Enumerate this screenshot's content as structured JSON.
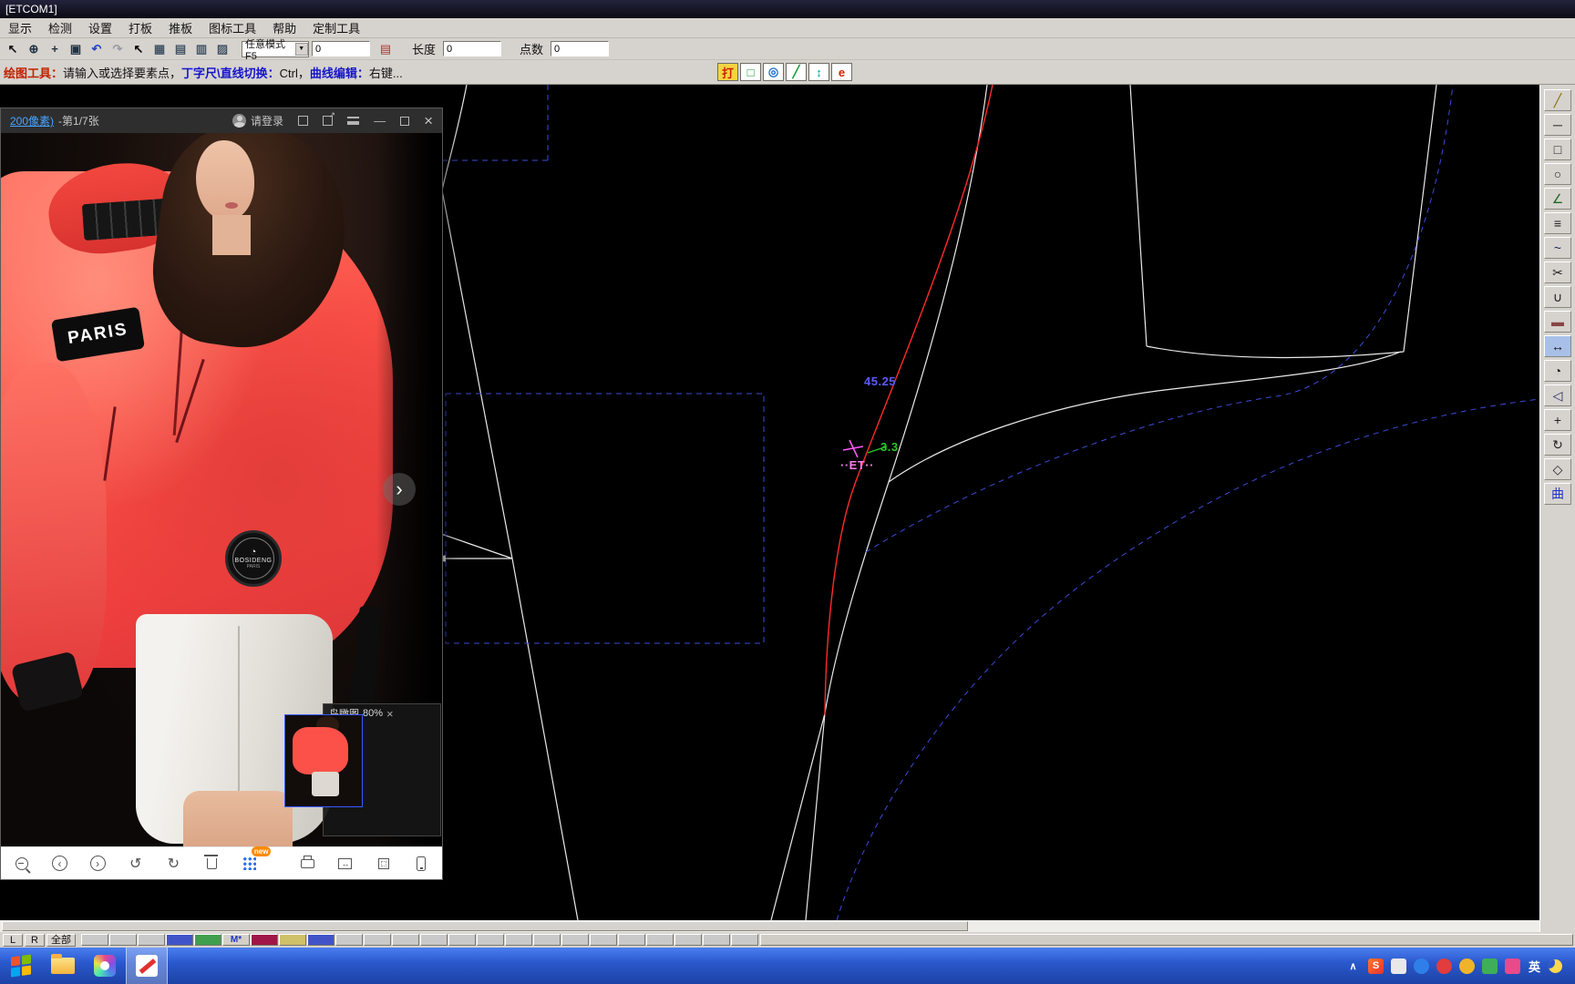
{
  "titlebar": {
    "title": "[ETCOM1]"
  },
  "menubar": {
    "items": [
      {
        "name": "menu-display",
        "label": "显示"
      },
      {
        "name": "menu-detect",
        "label": "检测"
      },
      {
        "name": "menu-settings",
        "label": "设置"
      },
      {
        "name": "menu-pattern",
        "label": "打板"
      },
      {
        "name": "menu-grading",
        "label": "推板"
      },
      {
        "name": "menu-icon-tools",
        "label": "图标工具"
      },
      {
        "name": "menu-help",
        "label": "帮助"
      },
      {
        "name": "menu-custom-tools",
        "label": "定制工具"
      }
    ]
  },
  "toolbar": {
    "icons": [
      {
        "name": "select-arrow-icon",
        "glyph": "↖",
        "color": "#111111"
      },
      {
        "name": "zoom-in-icon",
        "glyph": "⊕",
        "color": "#223344"
      },
      {
        "name": "pan-icon",
        "glyph": "+",
        "color": "#223344"
      },
      {
        "name": "zoom-area-icon",
        "glyph": "▣",
        "color": "#223344"
      },
      {
        "name": "undo-icon",
        "glyph": "↶",
        "color": "#2244cc"
      },
      {
        "name": "redo-icon",
        "glyph": "↷",
        "color": "#9a9aa6"
      },
      {
        "name": "pick-arrow-icon",
        "glyph": "↖",
        "color": "#000000"
      },
      {
        "name": "table-tool-1-icon",
        "glyph": "▦",
        "color": "#445566"
      },
      {
        "name": "table-tool-2-icon",
        "glyph": "▤",
        "color": "#445566"
      },
      {
        "name": "table-tool-3-icon",
        "glyph": "▥",
        "color": "#445566"
      },
      {
        "name": "table-tool-4-icon",
        "glyph": "▨",
        "color": "#445566"
      }
    ],
    "mode": "任意模式F5",
    "dropdown_arrow": "▼",
    "value": "0",
    "doc_icon": "▤",
    "length_label": "长度",
    "length_value": "0",
    "count_label": "点数",
    "count_value": "0"
  },
  "hintbar": {
    "seg1": "绘图工具：",
    "seg2": "请输入或选择要素点，",
    "seg3": "丁字尺\\直线切换：",
    "seg4": " Ctrl，",
    "seg5": "曲线编辑：",
    "seg6": " 右键...",
    "toggles": [
      {
        "name": "toggle-da",
        "glyph": "打",
        "color": "#cc2200",
        "bg": "#f5d442"
      },
      {
        "name": "toggle-rect",
        "glyph": "□",
        "color": "#1a9c3c",
        "bg": "#ffffff"
      },
      {
        "name": "toggle-point",
        "glyph": "◎",
        "color": "#1a6ccc",
        "bg": "#ffffff"
      },
      {
        "name": "toggle-line",
        "glyph": "╱",
        "color": "#1a9c3c",
        "bg": "#ffffff"
      },
      {
        "name": "toggle-swap",
        "glyph": "↕",
        "color": "#00a0a0",
        "bg": "#ffffff"
      },
      {
        "name": "toggle-e",
        "glyph": "e",
        "color": "#cc2200",
        "bg": "#ffffff"
      }
    ]
  },
  "canvas": {
    "dim_length": "45.25",
    "dim_angle": "3.3",
    "dim_label": "··ET··"
  },
  "viewer": {
    "title_link": "200像素)",
    "title_rest": " -第1/7张",
    "login": "请登录",
    "open_arrow": "↗",
    "min_glyph": "—",
    "close_glyph": "×",
    "paris": "PARIS",
    "logo_glyph": "◔",
    "logo_title": "BOSIDENG",
    "logo_sub": "PARIS",
    "next": "›",
    "prev_glyph": "‹",
    "next_glyph": "›",
    "rotate_left_glyph": "↺",
    "rotate_right_glyph": "↻",
    "fit_glyph": "↔",
    "new_badge": "new",
    "be_title": "鸟瞰图",
    "be_zoom": "80%",
    "be_close": "×"
  },
  "right_toolbar": {
    "tools": [
      {
        "name": "pencil-tool",
        "glyph": "╱",
        "color": "#8a6d00",
        "bg": ""
      },
      {
        "name": "line-tool",
        "glyph": "─",
        "color": "#222222",
        "bg": ""
      },
      {
        "name": "rect-tool",
        "glyph": "□",
        "color": "#222222",
        "bg": ""
      },
      {
        "name": "circle-tool",
        "glyph": "○",
        "color": "#222222",
        "bg": ""
      },
      {
        "name": "angle-line-tool",
        "glyph": "∠",
        "color": "#226622",
        "bg": ""
      },
      {
        "name": "divide-tool",
        "glyph": "≡",
        "color": "#222222",
        "bg": ""
      },
      {
        "name": "curve-tool",
        "glyph": "~",
        "color": "#222266",
        "bg": ""
      },
      {
        "name": "scissors-tool",
        "glyph": "✂",
        "color": "#222222",
        "bg": ""
      },
      {
        "name": "join-tool",
        "glyph": "∪",
        "color": "#222222",
        "bg": ""
      },
      {
        "name": "eraser-tool",
        "glyph": "▬",
        "color": "#884444",
        "bg": ""
      },
      {
        "name": "measure-tool",
        "glyph": "↔",
        "color": "#111111",
        "bg": "#a8c0e8"
      },
      {
        "name": "protractor-tool",
        "glyph": "◔",
        "color": "#222222",
        "bg": ""
      },
      {
        "name": "mirror-tool",
        "glyph": "◁",
        "color": "#222266",
        "bg": ""
      },
      {
        "name": "move-tool",
        "glyph": "+",
        "color": "#222222",
        "bg": ""
      },
      {
        "name": "rotate-tool",
        "glyph": "↻",
        "color": "#222222",
        "bg": ""
      },
      {
        "name": "scale-tool",
        "glyph": "◇",
        "color": "#222222",
        "bg": ""
      },
      {
        "name": "curve-mode-label",
        "glyph": "曲",
        "color": "#2233cc",
        "bg": ""
      }
    ]
  },
  "palette": {
    "left": "L",
    "right": "R",
    "all": "全部",
    "swatches": [
      {
        "name": "swatch-gray-1",
        "bg": "#c9c9c9",
        "label": ""
      },
      {
        "name": "swatch-gray-2",
        "bg": "#c9c9c9",
        "label": ""
      },
      {
        "name": "swatch-gray-3",
        "bg": "#c9c9c9",
        "label": ""
      },
      {
        "name": "swatch-blue-1",
        "bg": "#4054c8",
        "label": ""
      },
      {
        "name": "swatch-green",
        "bg": "#3f9f4f",
        "label": ""
      },
      {
        "name": "swatch-m",
        "bg": "#d4d0c8",
        "label": "M*"
      },
      {
        "name": "swatch-crimson",
        "bg": "#a01648",
        "label": ""
      },
      {
        "name": "swatch-khaki",
        "bg": "#cfc06a",
        "label": ""
      },
      {
        "name": "swatch-blue-2",
        "bg": "#4054c8",
        "label": ""
      },
      {
        "name": "swatch-gray-4",
        "bg": "#c9c9c9",
        "label": ""
      },
      {
        "name": "swatch-gray-5",
        "bg": "#c9c9c9",
        "label": ""
      },
      {
        "name": "swatch-gray-6",
        "bg": "#c9c9c9",
        "label": ""
      },
      {
        "name": "swatch-gray-7",
        "bg": "#c9c9c9",
        "label": ""
      },
      {
        "name": "swatch-gray-8",
        "bg": "#c9c9c9",
        "label": ""
      },
      {
        "name": "swatch-gray-9",
        "bg": "#c9c9c9",
        "label": ""
      },
      {
        "name": "swatch-gray-10",
        "bg": "#c9c9c9",
        "label": ""
      },
      {
        "name": "swatch-gray-11",
        "bg": "#c9c9c9",
        "label": ""
      },
      {
        "name": "swatch-gray-12",
        "bg": "#c9c9c9",
        "label": ""
      },
      {
        "name": "swatch-gray-13",
        "bg": "#c9c9c9",
        "label": ""
      },
      {
        "name": "swatch-gray-14",
        "bg": "#c9c9c9",
        "label": ""
      },
      {
        "name": "swatch-gray-15",
        "bg": "#c9c9c9",
        "label": ""
      },
      {
        "name": "swatch-gray-16",
        "bg": "#c9c9c9",
        "label": ""
      },
      {
        "name": "swatch-gray-17",
        "bg": "#c9c9c9",
        "label": ""
      },
      {
        "name": "swatch-gray-18",
        "bg": "#c9c9c9",
        "label": ""
      }
    ]
  },
  "taskbar": {
    "tray": [
      {
        "name": "tray-expand-icon",
        "glyph": "∧",
        "bg": "",
        "color": "#ffffff",
        "shape": ""
      },
      {
        "name": "tray-sogou-icon",
        "glyph": "S",
        "bg": "linear-gradient(135deg,#ff7a2a,#e83030)",
        "color": "#ffffff",
        "shape": "box"
      },
      {
        "name": "tray-ime-icon",
        "glyph": "",
        "bg": "#e8e8e8",
        "color": "#333333",
        "shape": "box"
      },
      {
        "name": "tray-app-blue-icon",
        "glyph": "",
        "bg": "#2f7fe8",
        "color": "#ffffff",
        "shape": "circle"
      },
      {
        "name": "tray-app-red-icon",
        "glyph": "",
        "bg": "#e23c3c",
        "color": "#ffffff",
        "shape": "circle"
      },
      {
        "name": "tray-app-yellow-icon",
        "glyph": "",
        "bg": "#f0b429",
        "color": "#ffffff",
        "shape": "circle"
      },
      {
        "name": "tray-app-green-icon",
        "glyph": "",
        "bg": "#3fae58",
        "color": "#ffffff",
        "shape": "box"
      },
      {
        "name": "tray-app-pink-icon",
        "glyph": "",
        "bg": "#e84a8a",
        "color": "#ffffff",
        "shape": "box"
      }
    ],
    "lang": "英"
  },
  "colors": {
    "jacket": "#fb5148",
    "taskbar_blue": "#2a58cc",
    "pattern_white": "#e9e9e9",
    "pattern_red": "#ff2a2a",
    "guide_blue": "#3b4bd8",
    "dim_blue": "#5b5bff",
    "dim_green": "#29c829",
    "dim_magenta": "#ff7bef"
  }
}
